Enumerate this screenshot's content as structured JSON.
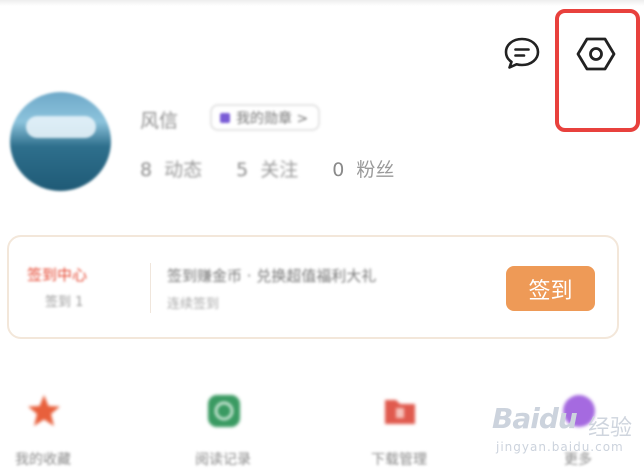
{
  "header": {
    "message_icon": "chat-bubble-icon",
    "settings_icon": "hexagon-settings-icon",
    "highlight_color": "#e8413d"
  },
  "profile": {
    "username": "风信",
    "level_badge": "我的勋章 >",
    "stats": [
      {
        "num": "8",
        "label": "动态"
      },
      {
        "num": "5",
        "label": "关注"
      },
      {
        "num": "0",
        "label": "粉丝"
      }
    ]
  },
  "signin_card": {
    "title": "签到中心",
    "subtitle": "签到 1",
    "line1": "签到赚金币 · 兑换超值福利大礼",
    "line2": "连续签到",
    "button": "签到",
    "button_color": "#ee9a57"
  },
  "shortcuts": [
    {
      "label": "我的收藏",
      "icon": "star-icon",
      "color": "#e8603c"
    },
    {
      "label": "阅读记录",
      "icon": "clock-icon",
      "color": "#3a9a62"
    },
    {
      "label": "下载管理",
      "icon": "download-folder-icon",
      "color": "#e05a4e"
    },
    {
      "label": "更多",
      "icon": "more-icon",
      "color": "#a56ae0"
    }
  ],
  "watermark": {
    "logo": "Baidu",
    "text": "经验",
    "sub": "jingyan.baidu.com"
  }
}
